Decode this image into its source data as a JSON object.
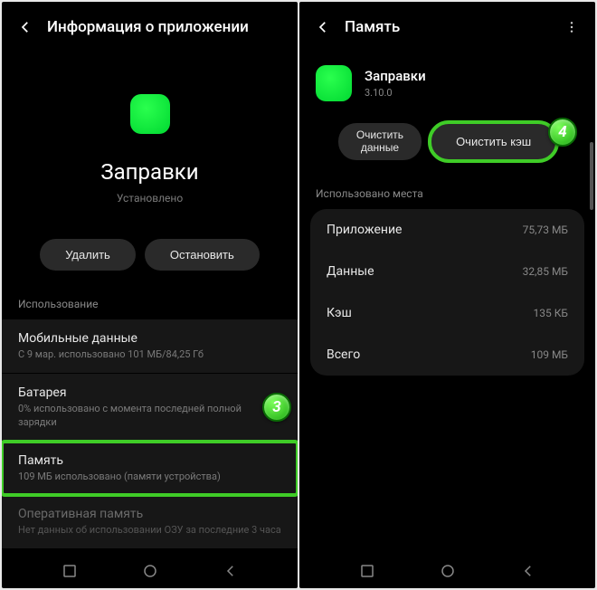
{
  "left": {
    "header_title": "Информация о приложении",
    "app_name": "Заправки",
    "app_status": "Установлено",
    "btn_uninstall": "Удалить",
    "btn_stop": "Остановить",
    "section_usage": "Использование",
    "items": [
      {
        "title": "Мобильные данные",
        "sub": "С 9 мар. использовано 101 МБ/84,25 Гб"
      },
      {
        "title": "Батарея",
        "sub": "0% использовано с момента последней полной зарядки"
      },
      {
        "title": "Память",
        "sub": "109 МБ использовано (памяти устройства)"
      },
      {
        "title": "Оперативная память",
        "sub": "Нет данных об использовании ОЗУ за последние 3 часа"
      }
    ],
    "badge": "3"
  },
  "right": {
    "header_title": "Память",
    "app_name": "Заправки",
    "app_version": "3.10.0",
    "btn_clear_data": "Очистить данные",
    "btn_clear_cache": "Очистить кэш",
    "section_space": "Использовано места",
    "rows": [
      {
        "k": "Приложение",
        "v": "75,73 МБ"
      },
      {
        "k": "Данные",
        "v": "32,85 МБ"
      },
      {
        "k": "Кэш",
        "v": "135 КБ"
      },
      {
        "k": "Всего",
        "v": "109 МБ"
      }
    ],
    "badge": "4"
  }
}
